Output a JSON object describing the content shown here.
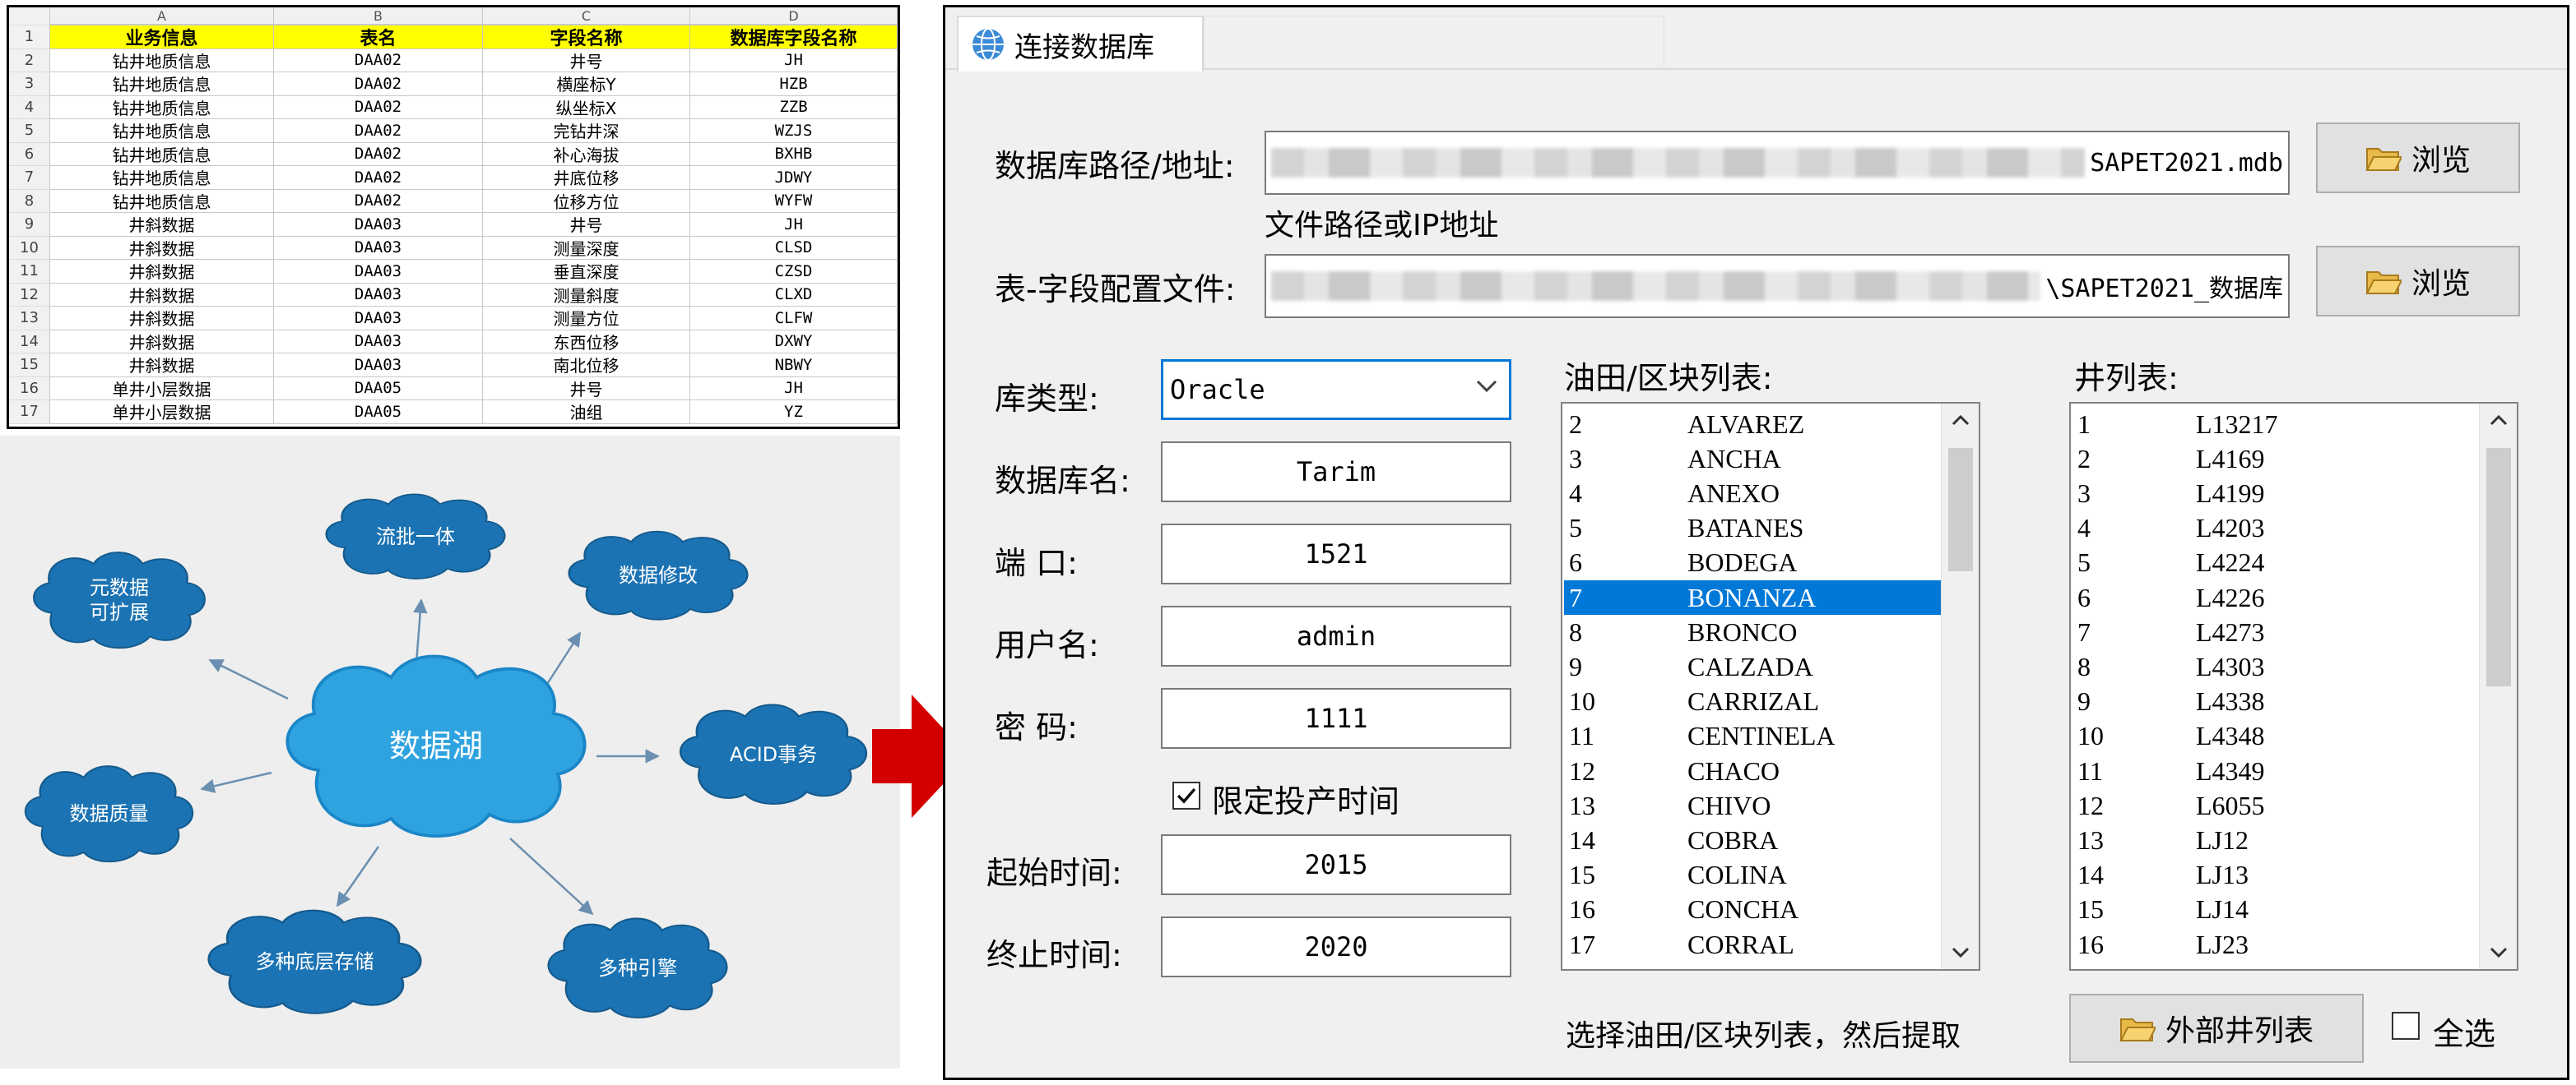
{
  "spreadsheet": {
    "column_letters": [
      "A",
      "B",
      "C",
      "D"
    ],
    "headers": [
      "业务信息",
      "表名",
      "字段名称",
      "数据库字段名称"
    ],
    "rows": [
      [
        "钻井地质信息",
        "DAA02",
        "井号",
        "JH"
      ],
      [
        "钻井地质信息",
        "DAA02",
        "横座标Y",
        "HZB"
      ],
      [
        "钻井地质信息",
        "DAA02",
        "纵坐标X",
        "ZZB"
      ],
      [
        "钻井地质信息",
        "DAA02",
        "完钻井深",
        "WZJS"
      ],
      [
        "钻井地质信息",
        "DAA02",
        "补心海拔",
        "BXHB"
      ],
      [
        "钻井地质信息",
        "DAA02",
        "井底位移",
        "JDWY"
      ],
      [
        "钻井地质信息",
        "DAA02",
        "位移方位",
        "WYFW"
      ],
      [
        "井斜数据",
        "DAA03",
        "井号",
        "JH"
      ],
      [
        "井斜数据",
        "DAA03",
        "测量深度",
        "CLSD"
      ],
      [
        "井斜数据",
        "DAA03",
        "垂直深度",
        "CZSD"
      ],
      [
        "井斜数据",
        "DAA03",
        "测量斜度",
        "CLXD"
      ],
      [
        "井斜数据",
        "DAA03",
        "测量方位",
        "CLFW"
      ],
      [
        "井斜数据",
        "DAA03",
        "东西位移",
        "DXWY"
      ],
      [
        "井斜数据",
        "DAA03",
        "南北位移",
        "NBWY"
      ],
      [
        "单井小层数据",
        "DAA05",
        "井号",
        "JH"
      ],
      [
        "单井小层数据",
        "DAA05",
        "油组",
        "YZ"
      ]
    ]
  },
  "data_lake": {
    "center": "数据湖",
    "nodes": {
      "metadata": "元数据\n可扩展",
      "stream_batch": "流批一体",
      "data_modify": "数据修改",
      "acid": "ACID事务",
      "engines": "多种引擎",
      "storage": "多种底层存储",
      "quality": "数据质量"
    }
  },
  "dialog": {
    "tab_title": "连接数据库",
    "db_path": {
      "label": "数据库路径/地址:",
      "value_tail": "SAPET2021.mdb",
      "hint": "文件路径或IP地址",
      "browse": "浏览"
    },
    "config_file": {
      "label": "表-字段配置文件:",
      "value_tail": "\\SAPET2021_数据库",
      "browse": "浏览"
    },
    "db_type": {
      "label": "库类型:",
      "value": "Oracle"
    },
    "db_name": {
      "label": "数据库名:",
      "value": "Tarim"
    },
    "port": {
      "label": "端  口:",
      "value": "1521"
    },
    "username": {
      "label": "用户名:",
      "value": "admin"
    },
    "password": {
      "label": "密  码:",
      "value": "1111"
    },
    "limit_time": {
      "label": "限定投产时间",
      "checked": true
    },
    "start_time": {
      "label": "起始时间:",
      "value": "2015"
    },
    "end_time": {
      "label": "终止时间:",
      "value": "2020"
    },
    "field_list": {
      "label": "油田/区块列表:",
      "selected_index": 5,
      "items": [
        [
          "2",
          "ALVAREZ"
        ],
        [
          "3",
          "ANCHA"
        ],
        [
          "4",
          "ANEXO"
        ],
        [
          "5",
          "BATANES"
        ],
        [
          "6",
          "BODEGA"
        ],
        [
          "7",
          "BONANZA"
        ],
        [
          "8",
          "BRONCO"
        ],
        [
          "9",
          "CALZADA"
        ],
        [
          "10",
          "CARRIZAL"
        ],
        [
          "11",
          "CENTINELA"
        ],
        [
          "12",
          "CHACO"
        ],
        [
          "13",
          "CHIVO"
        ],
        [
          "14",
          "COBRA"
        ],
        [
          "15",
          "COLINA"
        ],
        [
          "16",
          "CONCHA"
        ],
        [
          "17",
          "CORRAL"
        ]
      ]
    },
    "well_list": {
      "label": "井列表:",
      "items": [
        [
          "1",
          "L13217"
        ],
        [
          "2",
          "L4169"
        ],
        [
          "3",
          "L4199"
        ],
        [
          "4",
          "L4203"
        ],
        [
          "5",
          "L4224"
        ],
        [
          "6",
          "L4226"
        ],
        [
          "7",
          "L4273"
        ],
        [
          "8",
          "L4303"
        ],
        [
          "9",
          "L4338"
        ],
        [
          "10",
          "L4348"
        ],
        [
          "11",
          "L4349"
        ],
        [
          "12",
          "L6055"
        ],
        [
          "13",
          "LJ12"
        ],
        [
          "14",
          "LJ13"
        ],
        [
          "15",
          "LJ14"
        ],
        [
          "16",
          "LJ23"
        ]
      ]
    },
    "hint_bottom": "选择油田/区块列表，然后提取",
    "external_wells_button": "外部井列表",
    "select_all": {
      "label": "全选",
      "checked": false
    },
    "colors": {
      "selection": "#0078d7",
      "cloud": "#1b73b3",
      "arrow_red": "#d40000"
    }
  }
}
